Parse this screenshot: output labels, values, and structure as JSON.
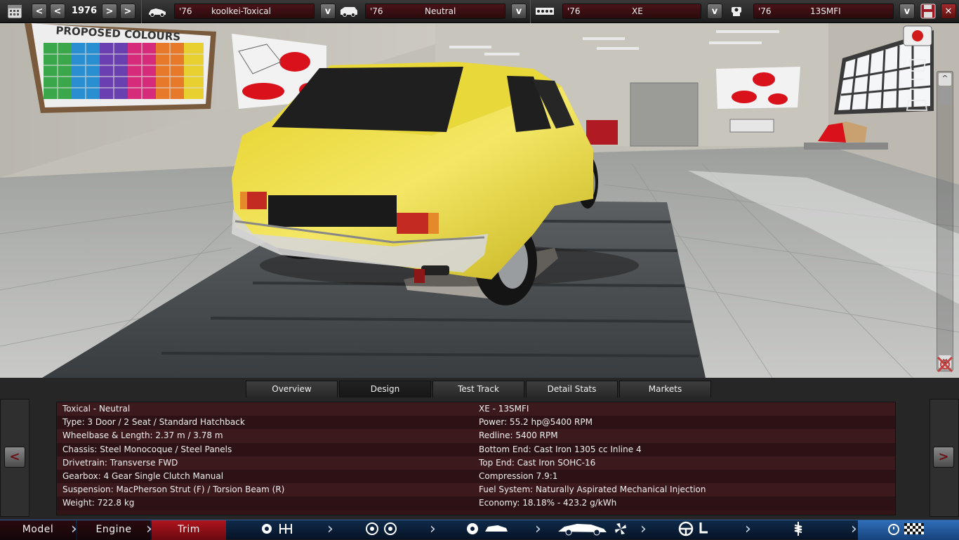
{
  "toolbar": {
    "year": "1976",
    "prev_fast": "<",
    "prev": "<",
    "next": ">",
    "next_fast": ">",
    "model": {
      "year": "'76",
      "name": "koolkei-Toxical"
    },
    "trim": {
      "year": "'76",
      "name": "Neutral"
    },
    "engine": {
      "year": "'76",
      "name": "XE"
    },
    "variant": {
      "year": "'76",
      "name": "13SMFI"
    },
    "dropdown_label": "v"
  },
  "scene": {
    "poster_title": "PROPOSED COLOURS",
    "car_color": "#e3cf2a"
  },
  "tabs": [
    {
      "label": "Overview"
    },
    {
      "label": "Design"
    },
    {
      "label": "Test Track"
    },
    {
      "label": "Detail Stats"
    },
    {
      "label": "Markets"
    }
  ],
  "side": {
    "left": "<",
    "right": ">"
  },
  "stats": {
    "left": [
      "Toxical - Neutral",
      "Type: 3 Door / 2 Seat / Standard Hatchback",
      "Wheelbase & Length: 2.37 m / 3.78 m",
      "Chassis: Steel Monocoque / Steel Panels",
      "Drivetrain: Transverse FWD",
      "Gearbox: 4 Gear Single Clutch Manual",
      "Suspension: MacPherson Strut (F) / Torsion Beam (R)",
      "Weight: 722.8 kg"
    ],
    "right": [
      "XE - 13SMFI",
      "Power: 55.2 hp@5400 RPM",
      "Redline: 5400 RPM",
      "Bottom End: Cast Iron 1305 cc Inline 4",
      "Top End: Cast Iron SOHC-16",
      "Compression 7.9:1",
      "Fuel System: Naturally Aspirated Mechanical Injection",
      "Economy: 18.18% - 423.2 g/kWh"
    ]
  },
  "nav": {
    "model": "Model",
    "engine": "Engine",
    "trim": "Trim"
  },
  "colors": {
    "active_nav": "#a3121c",
    "nav_bg": "#0b1f3a",
    "stat_bg": "#3b191c"
  }
}
